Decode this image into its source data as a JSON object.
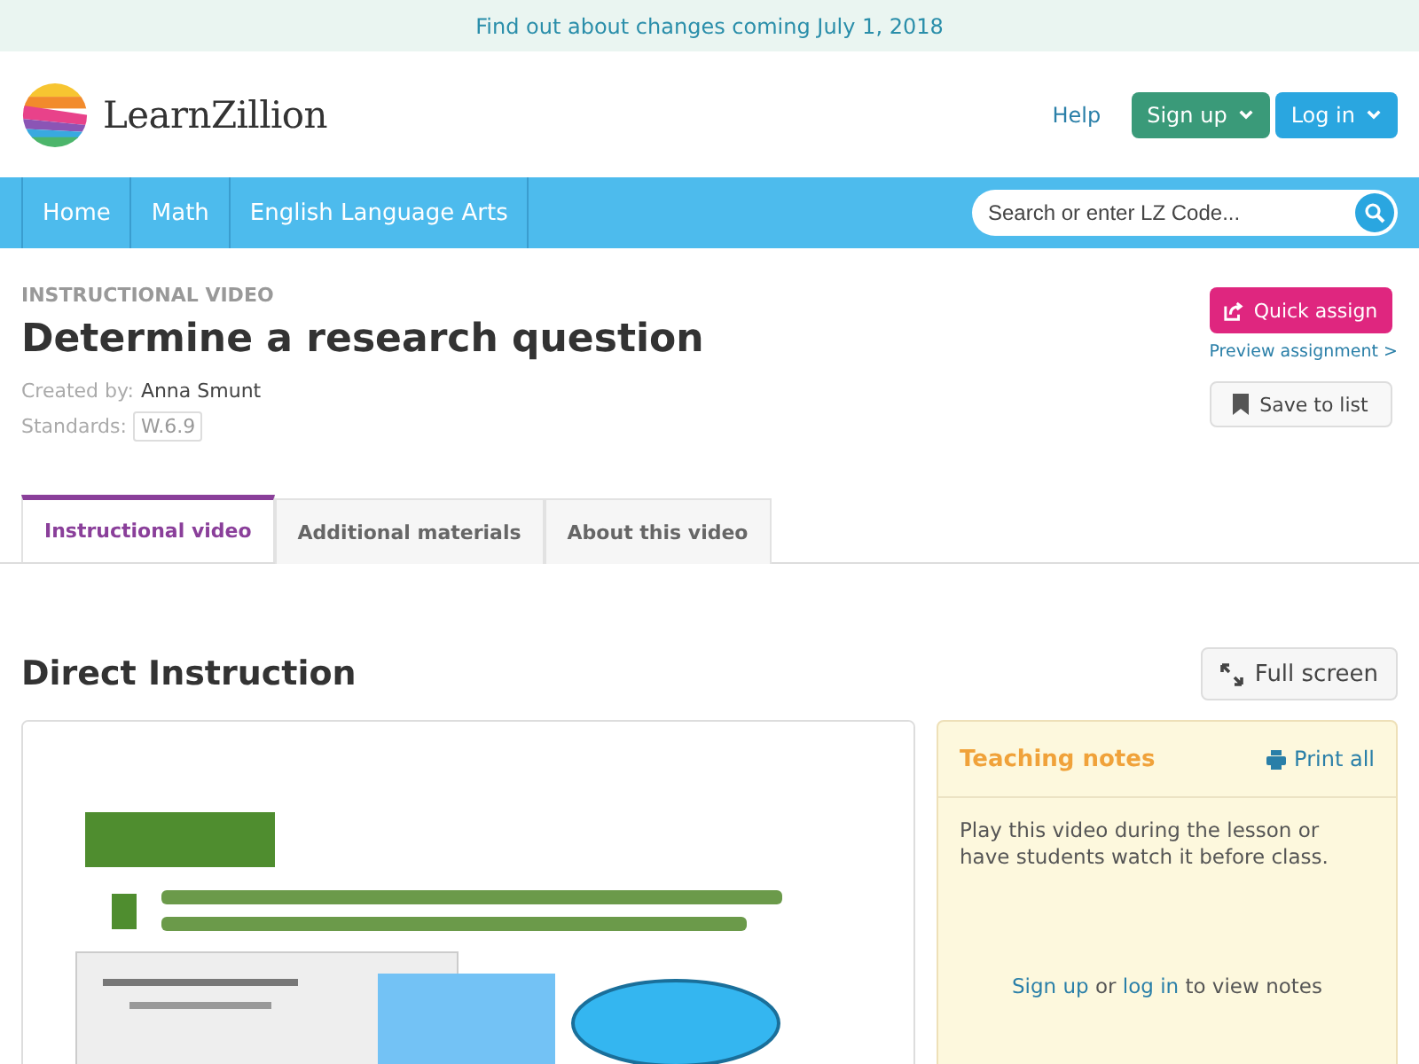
{
  "banner": {
    "text": "Find out about changes coming July 1, 2018"
  },
  "header": {
    "logo": "LearnZillion",
    "help": "Help",
    "buttons": [
      {
        "label": "Sign up",
        "kind": "signup"
      },
      {
        "label": "Log in",
        "kind": "login"
      }
    ]
  },
  "nav": {
    "items": [
      {
        "label": "Home"
      },
      {
        "label": "Math"
      },
      {
        "label": "English Language Arts"
      }
    ],
    "search": {
      "placeholder": "Search or enter LZ Code..."
    }
  },
  "lesson": {
    "eyebrow": "INSTRUCTIONAL VIDEO",
    "title": "Determine a research question",
    "created_label": "Created by:",
    "author": "Anna Smunt",
    "standards_label": "Standards:",
    "standard": "W.6.9",
    "quick_assign": "Quick assign",
    "preview": "Preview assignment >",
    "save": "Save to list"
  },
  "tabs": [
    {
      "label": "Instructional video",
      "selected": true
    },
    {
      "label": "Additional materials",
      "selected": false
    },
    {
      "label": "About this video",
      "selected": false
    }
  ],
  "section": {
    "title": "Direct Instruction",
    "full_screen": "Full screen"
  },
  "notes": {
    "title": "Teaching notes",
    "print": "Print all",
    "body": "Play this video during the lesson or have students watch it before class.",
    "prompt": [
      {
        "kind": "link",
        "text": "Sign up"
      },
      {
        "kind": "text",
        "text": "or"
      },
      {
        "kind": "link",
        "text": "log in"
      },
      {
        "kind": "text",
        "text": "to view notes"
      }
    ]
  }
}
